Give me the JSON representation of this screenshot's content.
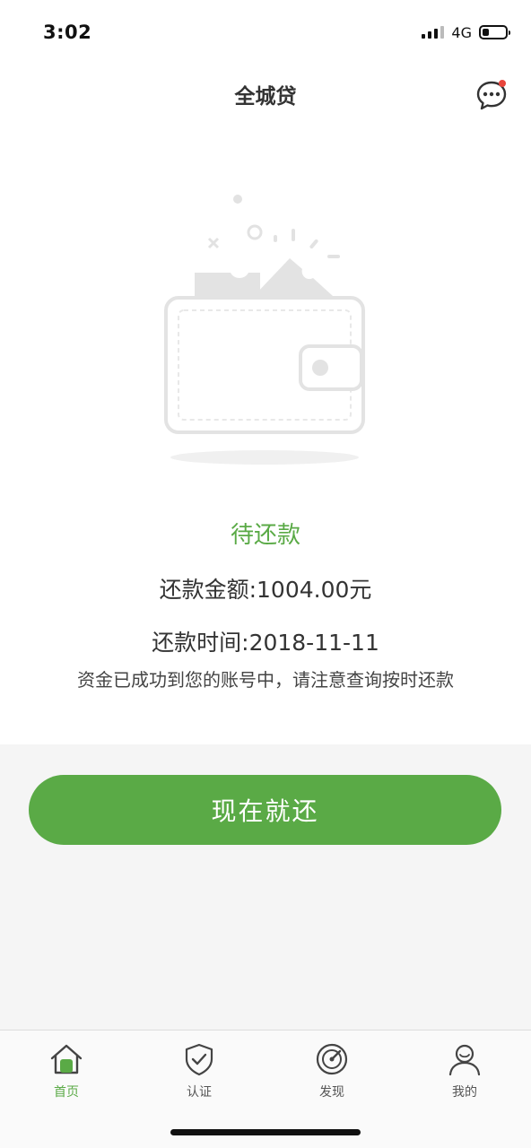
{
  "status_bar": {
    "time": "3:02",
    "network": "4G"
  },
  "header": {
    "title": "全城贷",
    "chat_icon": "chat-bubble-icon"
  },
  "illustration": {
    "icon": "empty-wallet-icon"
  },
  "repayment": {
    "status": "待还款",
    "amount": "还款金额:1004.00元",
    "date": "还款时间:2018-11-11",
    "notice": "资金已成功到您的账号中，请注意查询按时还款"
  },
  "actions": {
    "pay_now": "现在就还"
  },
  "tabs": [
    {
      "label": "首页",
      "icon": "home-icon",
      "active": true
    },
    {
      "label": "认证",
      "icon": "shield-check-icon",
      "active": false
    },
    {
      "label": "发现",
      "icon": "compass-icon",
      "active": false
    },
    {
      "label": "我的",
      "icon": "user-icon",
      "active": false
    }
  ],
  "colors": {
    "accent": "#5aaa46",
    "badge": "#e8453c"
  }
}
